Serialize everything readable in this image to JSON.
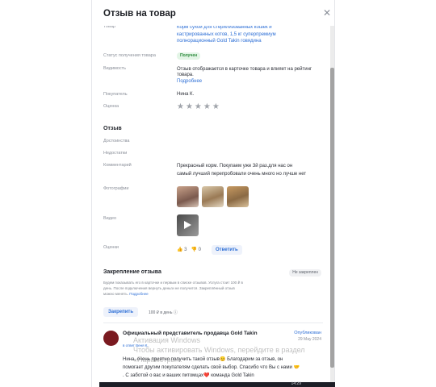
{
  "modal": {
    "title": "Отзыв на товар",
    "close_icon": "close-icon"
  },
  "product": {
    "label": "Товар",
    "name_line1": "Корм сухой для стерилизованных кошек и",
    "name_line2": "кастрированных котов, 1,5 кг суперпремиум",
    "name_line3": "полнорационный Gold Takin говядина"
  },
  "status": {
    "label": "Статус получения товара",
    "value": "Получен"
  },
  "visibility": {
    "label": "Видимость",
    "line1": "Отзыв отображается в карточке товара и влияет на рейтинг",
    "line2": "товара.",
    "more": "Подробнее"
  },
  "buyer": {
    "label": "Покупатель",
    "value": "Нина К."
  },
  "rating": {
    "label": "Оценка",
    "stars": "★★★★★",
    "value": 5
  },
  "review": {
    "heading": "Отзыв",
    "pros_label": "Достоинства",
    "cons_label": "Недостатки",
    "comment_label": "Комментарий",
    "comment_line1": "Прекрасный корм. Покупаем уже 3й раз.для нас он",
    "comment_line2": "самый лучший перепробовали очень много но лучше нет",
    "photos_label": "Фотографии",
    "video_label": "Видео",
    "score_label": "Оценки",
    "likes": "3",
    "dislikes": "0",
    "reply_label": "Ответить"
  },
  "pin": {
    "heading": "Закрепление отзыва",
    "badge": "Не закреплен",
    "desc_line1": "Будем показывать его в карточке и первым в списке отзывов. Услуга стоит 100 ₽ в",
    "desc_line2": "день. После подключения вернуть деньги не получится. Закреплённый отзыв",
    "desc_line3": "можно менять.",
    "desc_more": "Подробнее",
    "button": "Закрепить",
    "price": "100 ₽",
    "price_suffix": "в день"
  },
  "answer": {
    "seller": "Официальный представитель продавца Gold Takin",
    "seller_sub": "в ответ Веня К.",
    "status": "Опубликован",
    "date": "29 May 2024",
    "line1": "Нина, очень приятно получить такой отзыв😊 Благодарим за отзыв, он",
    "line2": "помогает другим покупателям сделать свой выбор. Спасибо что Вы с нами 🤝",
    "line3": ". С заботой о вас и ваших питомцах❤️ команда Gold Takin"
  },
  "watermark": {
    "line1": "Активация Windows",
    "line2": "Чтобы активировать Windows, перейдите в раздел",
    "line3": "«Параметры»."
  },
  "taskbar": {
    "time": "14:29"
  },
  "colors": {
    "accent": "#2d6fd6",
    "status_green": "#2c8a3c"
  }
}
